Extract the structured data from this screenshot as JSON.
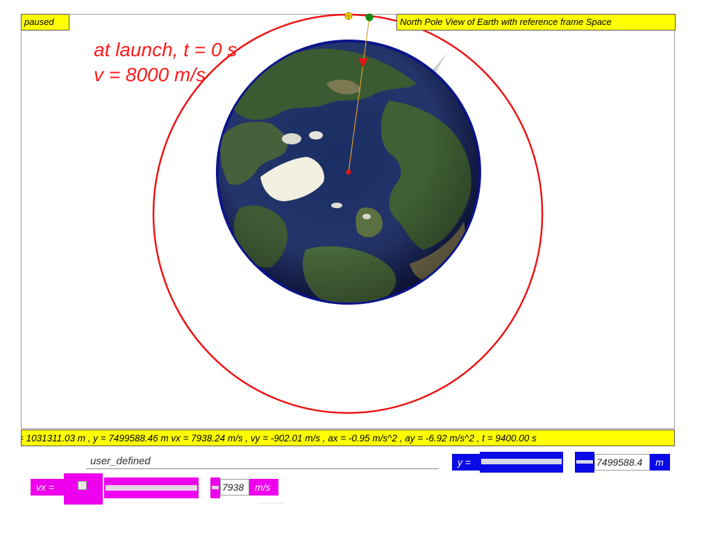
{
  "sim": {
    "status": "paused",
    "view_title": "North Pole View of Earth with reference frame Space",
    "annotation_line1": "at launch, t = 0 s",
    "annotation_line2": "v = 8000 m/s",
    "readout": "= 1031311.03 m , y = 7499588.46 m vx = 7938.24 m/s , vy = -902.01 m/s , ax = -0.95 m/s^2 , ay = -6.92 m/s^2 , t = 9400.00 s"
  },
  "colors": {
    "orbit": "#ee1111",
    "highlight_bar": "#ffff00",
    "y_control": "#0a0ae6",
    "vx_control": "#ee00ee",
    "earth_ocean": "#1c2f6a",
    "earth_rim": "#101a8c",
    "ice": "#f2f0e0",
    "satellite": "#138a13"
  },
  "controls": {
    "orbit_mode": "user_defined",
    "y_label": "y =",
    "y_value": "7499588.4",
    "y_unit": "m",
    "vx_label": "vx =",
    "vx_value": "7938",
    "vx_unit": "m/s"
  },
  "icons": {
    "satellite": "green-dot-icon",
    "launch_site": "yellow-crosshair-icon",
    "earth_center": "red-dot-icon",
    "velocity_arrow": "red-triangle-arrow-icon"
  }
}
